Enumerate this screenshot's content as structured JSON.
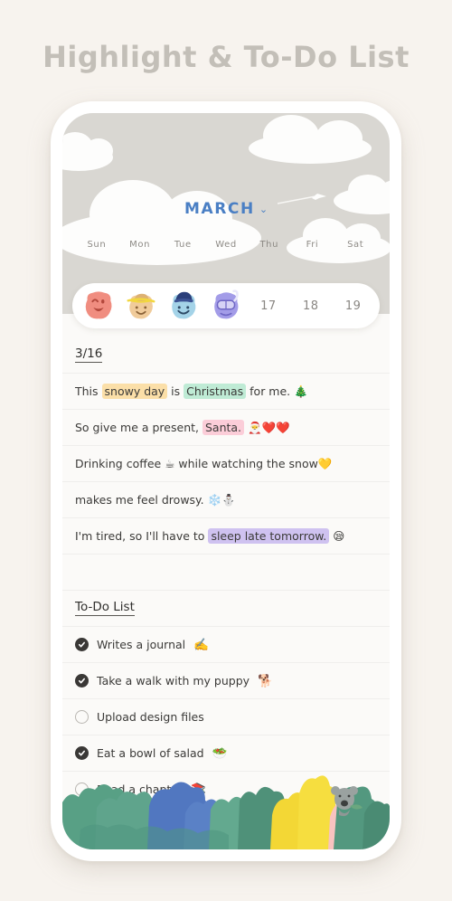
{
  "headline": "Highlight & To-Do List",
  "calendar": {
    "month": "MARCH",
    "chevron": "⌄",
    "weekdays": [
      "Sun",
      "Mon",
      "Tue",
      "Wed",
      "Thu",
      "Fri",
      "Sat"
    ],
    "daystrip": [
      {
        "type": "sticker",
        "icon": "face-sticker-wink",
        "label": ""
      },
      {
        "type": "sticker",
        "icon": "face-sticker-strawhat",
        "label": ""
      },
      {
        "type": "sticker",
        "icon": "face-sticker-cap",
        "label": ""
      },
      {
        "type": "sticker",
        "icon": "face-sticker-snorkel",
        "label": ""
      },
      {
        "type": "date",
        "icon": "",
        "label": "17"
      },
      {
        "type": "date",
        "icon": "",
        "label": "18"
      },
      {
        "type": "date",
        "icon": "",
        "label": "19"
      }
    ]
  },
  "journal": {
    "date_heading": "3/16",
    "lines": [
      {
        "parts": [
          {
            "text": "This ",
            "highlight": ""
          },
          {
            "text": "snowy day",
            "highlight": "#fbdfa8"
          },
          {
            "text": " is ",
            "highlight": ""
          },
          {
            "text": "Christmas",
            "highlight": "#bfebd5"
          },
          {
            "text": " for me. ",
            "highlight": ""
          },
          {
            "text": "🎄",
            "highlight": ""
          }
        ]
      },
      {
        "parts": [
          {
            "text": "So give me a present, ",
            "highlight": ""
          },
          {
            "text": "Santa.",
            "highlight": "#fbcdd8"
          },
          {
            "text": " ",
            "highlight": ""
          },
          {
            "text": "🎅❤️❤️",
            "highlight": ""
          }
        ]
      },
      {
        "parts": [
          {
            "text": "Drinking coffee ",
            "highlight": ""
          },
          {
            "text": "☕",
            "highlight": ""
          },
          {
            "text": " while watching the snow",
            "highlight": ""
          },
          {
            "text": "💛",
            "highlight": ""
          }
        ]
      },
      {
        "parts": [
          {
            "text": "makes me feel drowsy. ",
            "highlight": ""
          },
          {
            "text": "❄️⛄",
            "highlight": ""
          }
        ]
      },
      {
        "parts": [
          {
            "text": "I'm tired, so I'll have to ",
            "highlight": ""
          },
          {
            "text": "sleep late tomorrow.",
            "highlight": "#cfc2f0"
          },
          {
            "text": " ",
            "highlight": ""
          },
          {
            "text": "😪",
            "highlight": ""
          }
        ]
      },
      {
        "parts": []
      }
    ]
  },
  "todo": {
    "heading": "To-Do List",
    "items": [
      {
        "label": "Writes a journal",
        "emoji": "✍️",
        "done": true
      },
      {
        "label": "Take a walk with my puppy",
        "emoji": "🐕",
        "done": true
      },
      {
        "label": "Upload design files",
        "emoji": "",
        "done": false
      },
      {
        "label": "Eat a bowl of salad",
        "emoji": "🥗",
        "done": true
      },
      {
        "label": "Read a chapter",
        "emoji": "📚",
        "done": false
      }
    ]
  },
  "colors": {
    "page_background": "#f7f3ee",
    "headline": "#c3bfb8",
    "sky": "#d9d7d2",
    "month_accent": "#4a7fc4",
    "note_background": "#fbfaf8",
    "checkbox_done": "#3a3836",
    "checkbox_todo_border": "#b9b6b1",
    "forest_green": "#5d9a82",
    "forest_blue": "#5b7fc0",
    "forest_yellow": "#f6d83c",
    "forest_pink": "#f8c3c0"
  }
}
